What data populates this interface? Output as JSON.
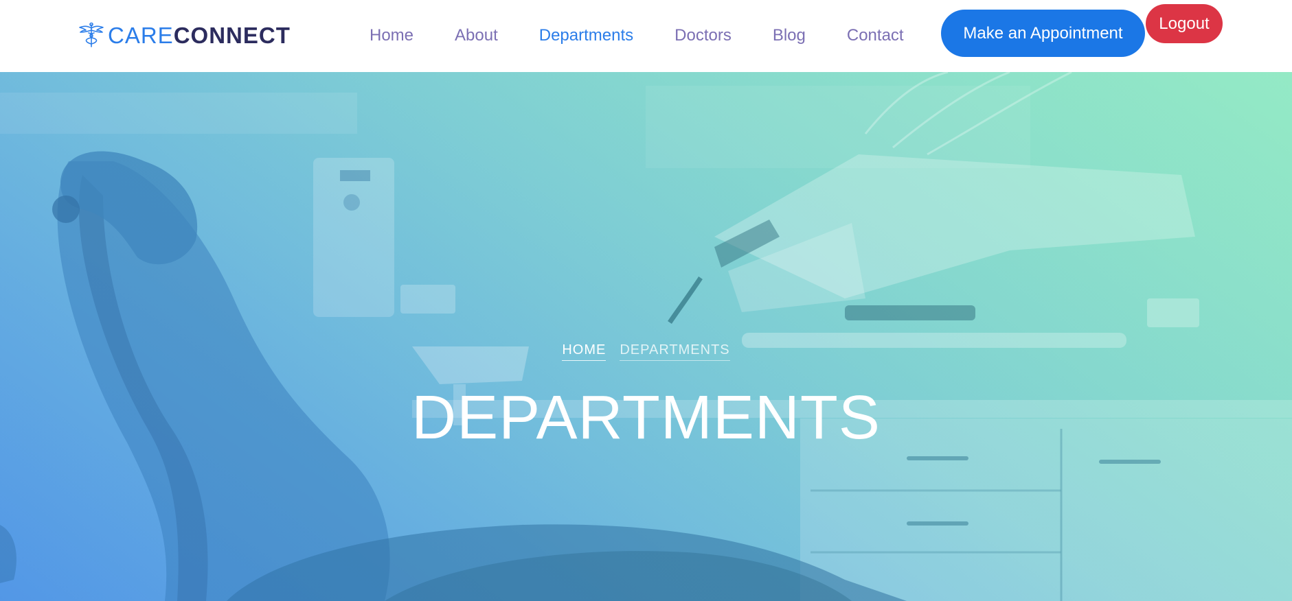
{
  "brand": {
    "name_part1": "CARE",
    "name_part2": "CONNECT",
    "icon": "caduceus-icon",
    "colors": {
      "primary": "#2b7de9",
      "dark": "#2c2c5e"
    }
  },
  "nav": {
    "items": [
      {
        "label": "Home",
        "active": false
      },
      {
        "label": "About",
        "active": false
      },
      {
        "label": "Departments",
        "active": true
      },
      {
        "label": "Doctors",
        "active": false
      },
      {
        "label": "Blog",
        "active": false
      },
      {
        "label": "Contact",
        "active": false
      }
    ],
    "link_color": "#7b6fb3",
    "active_color": "#2b7de9"
  },
  "actions": {
    "appointment_label": "Make an Appointment",
    "appointment_color": "#1b77e6",
    "logout_label": "Logout",
    "logout_color": "#dc3545"
  },
  "hero": {
    "breadcrumb": {
      "home": "HOME",
      "current": "DEPARTMENTS"
    },
    "title": "DEPARTMENTS",
    "gradient": [
      "#5a9ee8",
      "#76c1dc",
      "#84d6cf",
      "#93e9c4"
    ]
  }
}
